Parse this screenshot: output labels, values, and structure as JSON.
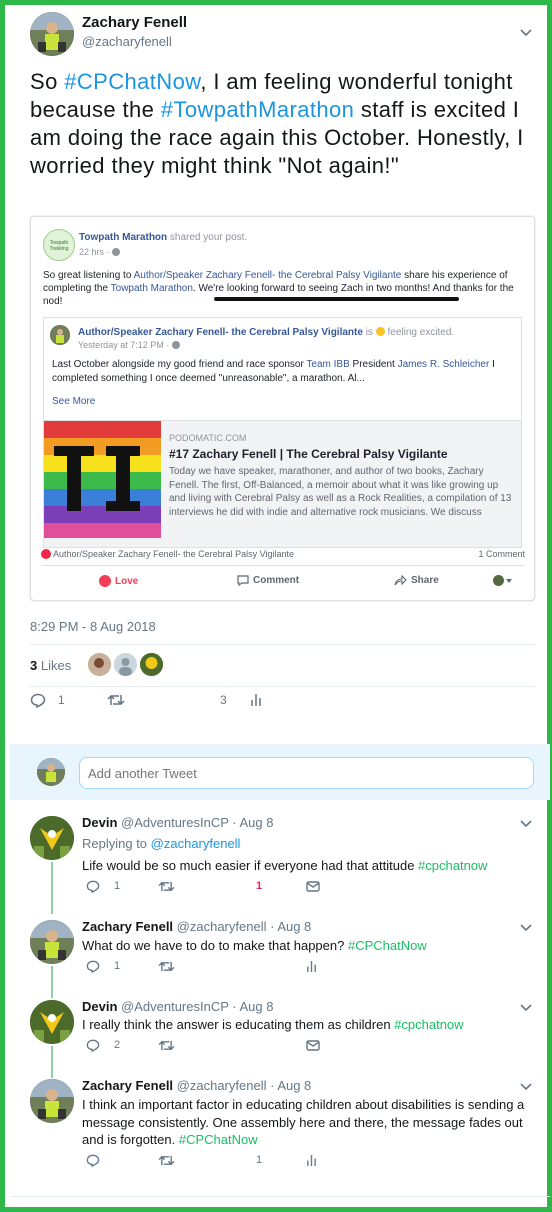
{
  "main_tweet": {
    "name": "Zachary Fenell",
    "handle": "@zacharyfenell",
    "text_parts": [
      "So ",
      "#CPChatNow",
      ", I am feeling wonderful tonight because the ",
      "#TowpathMarathon",
      " staff is excited I am doing the race again this October. Honestly, I worried they might think \"Not again!\""
    ],
    "timestamp": "8:29 PM - 8 Aug 2018",
    "likes_count": "3",
    "likes_label": "Likes",
    "reply_count": "1",
    "retweet_count": "",
    "like_count_action": "3"
  },
  "fb_post": {
    "page_name": "Towpath Marathon",
    "shared_text": "shared your post.",
    "time": "22 hrs · ",
    "logo_text": "Towpath Trekking",
    "body_pre": "So great listening to ",
    "body_link1": "Author/Speaker Zachary Fenell- the Cerebral Palsy Vigilante",
    "body_mid": " share his experience of completing the ",
    "body_link2": "Towpath Marathon",
    "body_post": ". We're looking forward to seeing Zach in two months! And thanks for the nod!",
    "inner_author": "Author/Speaker Zachary Fenell- the Cerebral Palsy Vigilante",
    "inner_is": "is",
    "inner_feeling": "feeling excited.",
    "inner_time": "Yesterday at 7:12 PM · ",
    "inner_body_pre": "Last October alongside my good friend and race sponsor ",
    "inner_body_link1": "Team IBB",
    "inner_body_mid": " President ",
    "inner_body_link2": "James R. Schleicher",
    "inner_body_post": " I completed something I once deemed \"unreasonable\", a marathon. Al...",
    "see_more": "See More",
    "link_domain": "PODOMATIC.COM",
    "link_title": "#17 Zachary Fenell | The Cerebral Palsy Vigilante",
    "link_desc": "Today we have speaker, marathoner, and author of two books, Zachary Fenell. The first, Off-Balanced, a memoir about what it was like growing up and living with Cerebral Palsy as well as a Rock Realities, a compilation of 13 interviews he did with indie and alternative rock musicians. We discuss",
    "thumb_text": "TI",
    "reaction_name": "Author/Speaker Zachary Fenell- the Cerebral Palsy Vigilante",
    "comments": "1 Comment",
    "love": "Love",
    "comment": "Comment",
    "share": "Share"
  },
  "reply_box": {
    "placeholder": "Add another Tweet"
  },
  "replies": [
    {
      "name": "Devin",
      "handle": "@AdventuresInCP",
      "date": "· Aug 8",
      "replying_to_label": "Replying to ",
      "replying_to": "@zacharyfenell",
      "text": "Life would be so much easier if everyone had that attitude ",
      "tag": "#cpchatnow",
      "reply_count": "1",
      "like_count": "1"
    },
    {
      "name": "Zachary Fenell",
      "handle": "@zacharyfenell",
      "date": "· Aug 8",
      "text": "What do we have to do to make that happen? ",
      "tag": "#CPChatNow",
      "reply_count": "1",
      "like_count": ""
    },
    {
      "name": "Devin",
      "handle": "@AdventuresInCP",
      "date": "· Aug 8",
      "text": "I really think the answer is educating them as children ",
      "tag": "#cpchatnow",
      "reply_count": "2",
      "like_count": ""
    },
    {
      "name": "Zachary Fenell",
      "handle": "@zacharyfenell",
      "date": "· Aug 8",
      "text": "I think an important factor in educating children about disabilities is sending a message consistently. One assembly here and there, the message fades out and is forgotten. ",
      "tag": "#CPChatNow",
      "reply_count": "",
      "like_count": "1"
    }
  ],
  "colors": {
    "border_green": "#2eb84a",
    "twitter_blue": "#1b95e0",
    "like_red": "#e0245e",
    "fb_blue": "#365899"
  }
}
